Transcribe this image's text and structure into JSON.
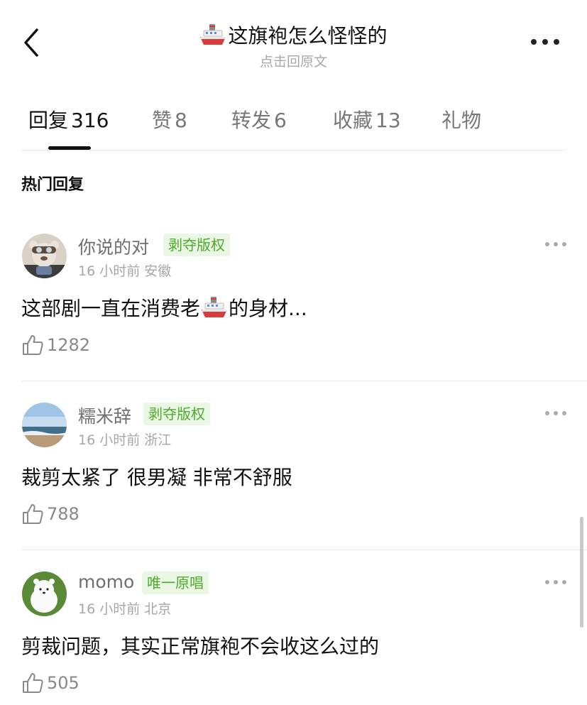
{
  "header": {
    "title": "这旗袍怎么怪怪的",
    "title_icon": "ship-emoji-icon",
    "subtitle": "点击回原文",
    "back_icon": "chevron-left-icon",
    "more_icon": "more-horizontal-icon"
  },
  "tabs": [
    {
      "label": "回复",
      "count": "316",
      "active": true
    },
    {
      "label": "赞",
      "count": "8",
      "active": false
    },
    {
      "label": "转发",
      "count": "6",
      "active": false
    },
    {
      "label": "收藏",
      "count": "13",
      "active": false
    },
    {
      "label": "礼物",
      "count": "",
      "active": false
    }
  ],
  "section": {
    "title": "热门回复"
  },
  "comments": [
    {
      "username": "你说的对",
      "badge": "剥夺版权",
      "time": "16 小时前",
      "location": "安徽",
      "text_before": "这部剧一直在消费老",
      "text_after": "的身材...",
      "text_icon": "ship-emoji-icon",
      "likes": "1282",
      "avatar": "teddy-bear-avatar"
    },
    {
      "username": "糯米辞",
      "badge": "剥夺版权",
      "time": "16 小时前",
      "location": "浙江",
      "text": "裁剪太紧了 很男凝 非常不舒服",
      "likes": "788",
      "avatar": "seaside-avatar"
    },
    {
      "username": "momo",
      "badge": "唯一原唱",
      "time": "16 小时前",
      "location": "北京",
      "text": "剪裁问题，其实正常旗袍不会收这么过的",
      "likes": "505",
      "avatar": "white-bear-avatar"
    }
  ],
  "colors": {
    "badge_bg": "#eaf7e4",
    "badge_text": "#4faa2c",
    "muted": "#a7a7a7",
    "divider": "#e9e9e9"
  }
}
